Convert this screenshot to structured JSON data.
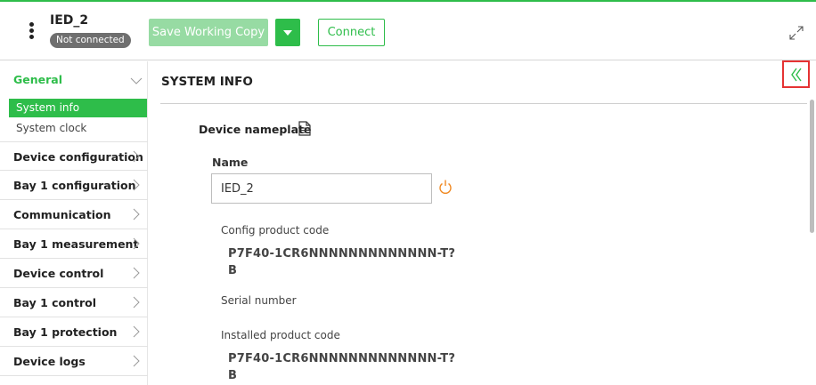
{
  "header": {
    "device_name": "IED_2",
    "status": "Not connected",
    "save_label": "Save Working Copy",
    "connect_label": "Connect",
    "accent_color": "#2ebd4a"
  },
  "sidebar": {
    "general": "General",
    "subitems": [
      "System info",
      "System clock"
    ],
    "items": [
      "Device configuration",
      "Bay 1 configuration",
      "Communication",
      "Bay 1 measurement",
      "Device control",
      "Bay 1 control",
      "Bay 1 protection",
      "Device logs"
    ]
  },
  "main": {
    "title": "SYSTEM INFO",
    "nameplate_label": "Device nameplate",
    "name_label": "Name",
    "name_value": "IED_2",
    "config_code_label": "Config product code",
    "config_code_value": "P7F40-1CR6NNNNNNNNNNNNN-T?B",
    "serial_label": "Serial number",
    "installed_code_label": "Installed product code",
    "installed_code_value": "P7F40-1CR6NNNNNNNNNNNNN-T?B"
  },
  "icons": {
    "kebab": "kebab-menu-icon",
    "dropdown": "caret-down-icon",
    "expand": "expand-icon",
    "collapse": "double-chevron-left-icon",
    "document": "document-icon",
    "reset": "power-reset-icon",
    "chevron": "chevron-right-icon"
  }
}
